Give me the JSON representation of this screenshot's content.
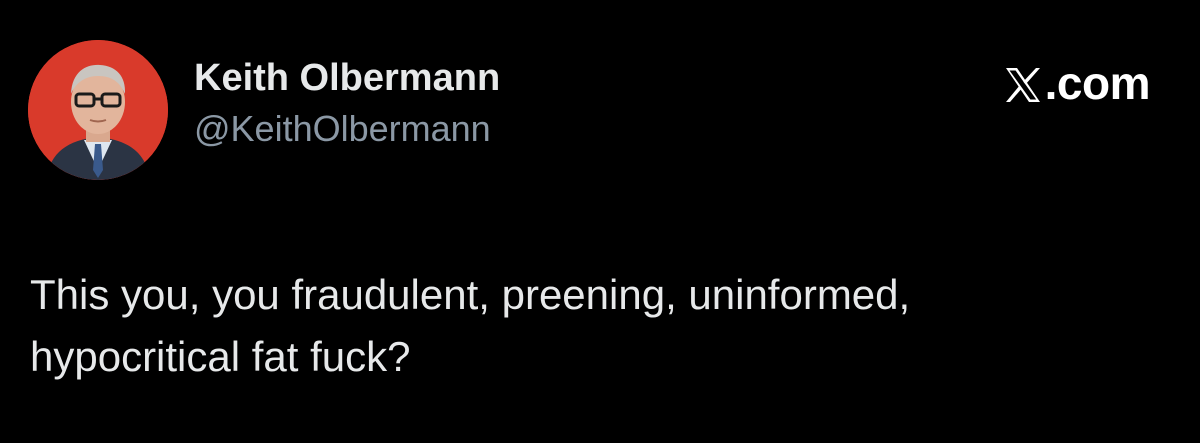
{
  "author": {
    "display_name": "Keith Olbermann",
    "handle": "@KeithOlbermann",
    "avatar_icon": "profile-photo",
    "avatar_bg_color": "#d93a2b"
  },
  "source": {
    "label": ".com",
    "logo_icon": "x-logo-icon"
  },
  "tweet": {
    "text_lines": [
      "This you, you fraudulent, preening, uninformed,",
      "hypocritical fat fuck?"
    ]
  },
  "colors": {
    "background": "#000000",
    "primary_text": "#e7e9ea",
    "secondary_text": "#8b98a5"
  }
}
